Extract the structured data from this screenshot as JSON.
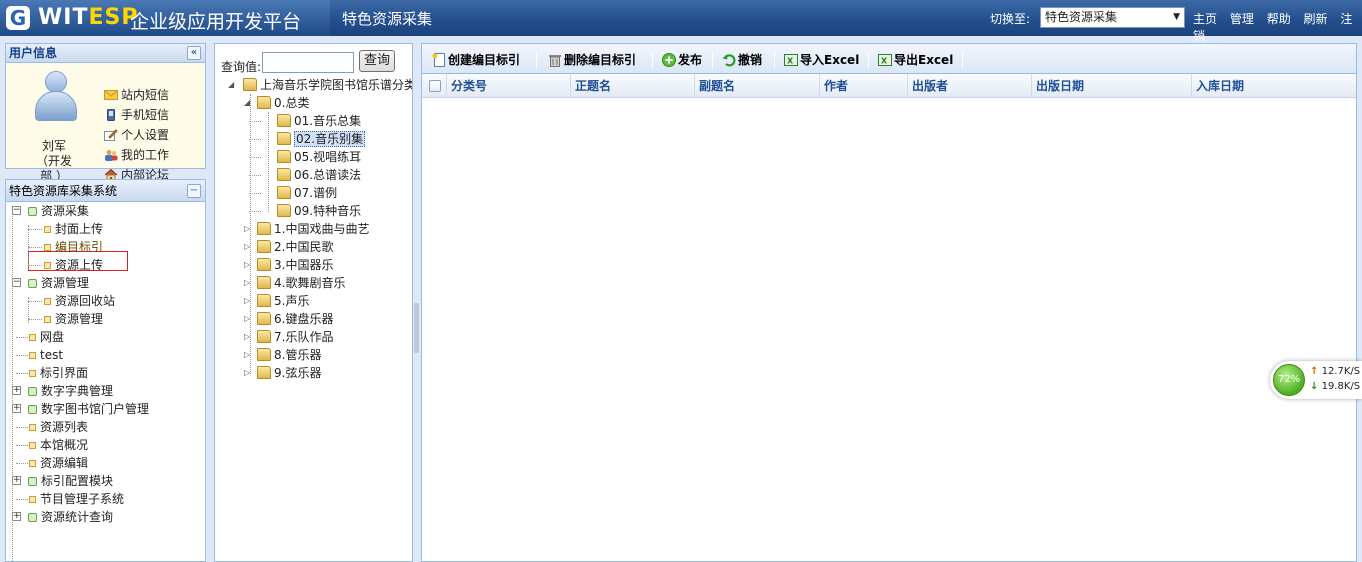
{
  "header": {
    "logo_letter": "G",
    "logo_wit": "WIT",
    "logo_esp": "ESP",
    "platform_name": "企业级应用开发平台",
    "app_title": "特色资源采集",
    "switch_label": "切换至:",
    "switch_value": "特色资源采集",
    "links": [
      "主页",
      "管理",
      "帮助",
      "刷新",
      "注销"
    ]
  },
  "user_panel": {
    "title": "用户信息",
    "collapse_icon": "«",
    "user_name_lines": [
      "刘军",
      "（开发",
      "部 ）"
    ],
    "links": [
      {
        "label": "站内短信",
        "icon": "mail-icon"
      },
      {
        "label": "手机短信",
        "icon": "phone-icon"
      },
      {
        "label": "个人设置",
        "icon": "edit-icon"
      },
      {
        "label": "我的工作",
        "icon": "users-icon"
      },
      {
        "label": "内部论坛",
        "icon": "home-icon"
      }
    ]
  },
  "system_panel": {
    "title": "特色资源库采集系统",
    "collapse_icon": "−",
    "tree": [
      {
        "label": "资源采集",
        "level": 0,
        "expanded": true
      },
      {
        "label": "封面上传",
        "level": 1
      },
      {
        "label": "编目标引",
        "level": 1,
        "selected": true
      },
      {
        "label": "资源上传",
        "level": 1
      },
      {
        "label": "资源管理",
        "level": 0,
        "expanded": true
      },
      {
        "label": "资源回收站",
        "level": 1
      },
      {
        "label": "资源管理",
        "level": 1
      },
      {
        "label": "网盘",
        "level": 0
      },
      {
        "label": "test",
        "level": 0
      },
      {
        "label": "标引界面",
        "level": 0
      },
      {
        "label": "数字字典管理",
        "level": 0,
        "expanded": false
      },
      {
        "label": "数字图书馆门户管理",
        "level": 0,
        "expanded": false
      },
      {
        "label": "资源列表",
        "level": 0
      },
      {
        "label": "本馆概况",
        "level": 0
      },
      {
        "label": "资源编辑",
        "level": 0
      },
      {
        "label": "标引配置模块",
        "level": 0,
        "expanded": false
      },
      {
        "label": "节目管理子系统",
        "level": 0
      },
      {
        "label": "资源统计查询",
        "level": 0,
        "expanded": false
      }
    ]
  },
  "category_panel": {
    "query_label": "查询值:",
    "query_value": "",
    "query_button": "查询",
    "root": "上海音乐学院图书馆乐谱分类",
    "nodes": [
      {
        "label": "0.总类",
        "level": 1,
        "expanded": true
      },
      {
        "label": "01.音乐总集",
        "level": 2
      },
      {
        "label": "02.音乐别集",
        "level": 2,
        "selected": true
      },
      {
        "label": "05.视唱练耳",
        "level": 2
      },
      {
        "label": "06.总谱读法",
        "level": 2
      },
      {
        "label": "07.谱例",
        "level": 2
      },
      {
        "label": "09.特种音乐",
        "level": 2
      },
      {
        "label": "1.中国戏曲与曲艺",
        "level": 1
      },
      {
        "label": "2.中国民歌",
        "level": 1
      },
      {
        "label": "3.中国器乐",
        "level": 1
      },
      {
        "label": "4.歌舞剧音乐",
        "level": 1
      },
      {
        "label": "5.声乐",
        "level": 1
      },
      {
        "label": "6.键盘乐器",
        "level": 1
      },
      {
        "label": "7.乐队作品",
        "level": 1
      },
      {
        "label": "8.管乐器",
        "level": 1
      },
      {
        "label": "9.弦乐器",
        "level": 1
      }
    ]
  },
  "grid": {
    "toolbar": [
      {
        "label": "创建编目标引",
        "icon": "new-doc-icon"
      },
      {
        "label": "删除编目标引",
        "icon": "trash-icon"
      },
      {
        "label": "发布",
        "icon": "plus-circle-icon"
      },
      {
        "label": "撤销",
        "icon": "undo-icon"
      },
      {
        "label": "导入Excel",
        "icon": "excel-import-icon"
      },
      {
        "label": "导出Excel",
        "icon": "excel-export-icon"
      }
    ],
    "columns": [
      "分类号",
      "正题名",
      "副题名",
      "作者",
      "出版者",
      "出版日期",
      "入库日期"
    ],
    "rows": []
  },
  "network_widget": {
    "percent": "72%",
    "upload": "12.7K/S",
    "download": "19.8K/S"
  },
  "colors": {
    "header_bg": "#24508f",
    "accent": "#15428b",
    "panel_border": "#99bbe8",
    "selection_border": "#e02020"
  }
}
